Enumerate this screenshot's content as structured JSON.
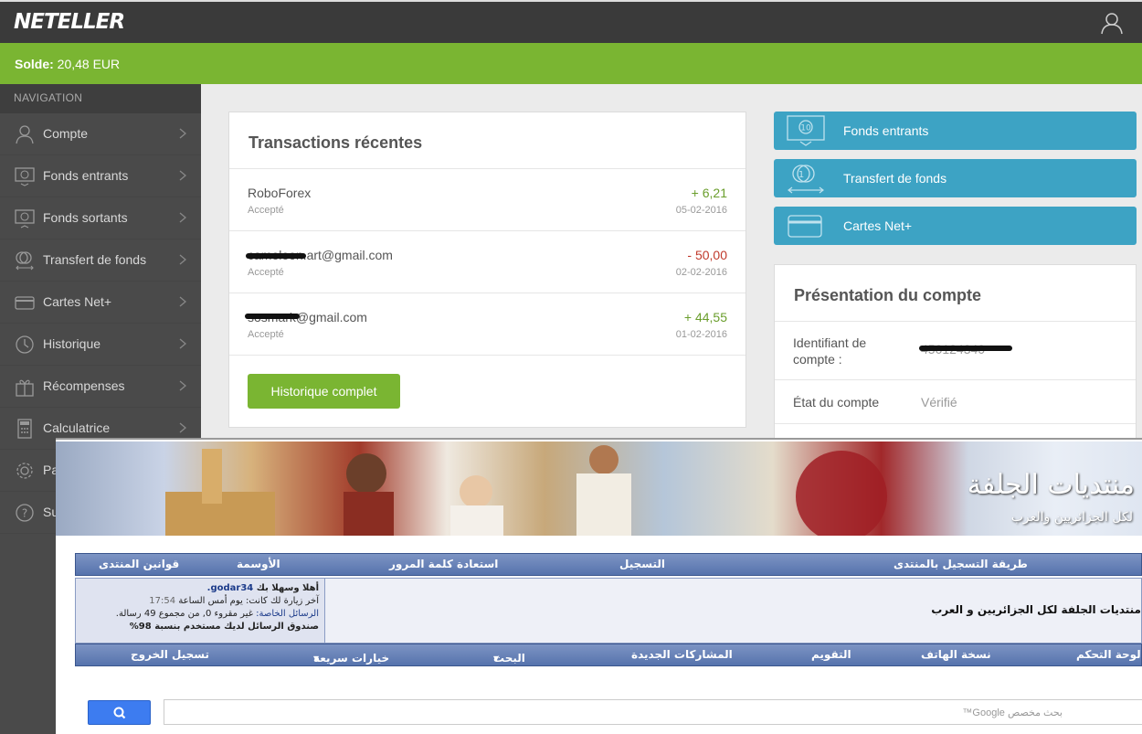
{
  "header": {
    "logo": "NETELLER",
    "user_icon": "user-icon"
  },
  "balance": {
    "label": "Solde:",
    "value": "20,48 EUR"
  },
  "sidebar": {
    "title": "NAVIGATION",
    "items": [
      {
        "label": "Compte",
        "icon": "user-icon"
      },
      {
        "label": "Fonds entrants",
        "icon": "money-in-icon"
      },
      {
        "label": "Fonds sortants",
        "icon": "money-out-icon"
      },
      {
        "label": "Transfert de fonds",
        "icon": "transfer-icon"
      },
      {
        "label": "Cartes Net+",
        "icon": "card-icon"
      },
      {
        "label": "Historique",
        "icon": "history-icon"
      },
      {
        "label": "Récompenses",
        "icon": "gift-icon"
      },
      {
        "label": "Calculatrice",
        "icon": "calculator-icon"
      },
      {
        "label": "Pa",
        "icon": "gear-icon"
      },
      {
        "label": "Su",
        "icon": "help-icon"
      }
    ]
  },
  "transactions": {
    "title": "Transactions récentes",
    "rows": [
      {
        "name": "RoboForex",
        "status": "Accepté",
        "amount": "+ 6,21",
        "date": "05-02-2016",
        "sign": "pos"
      },
      {
        "name": "cameleon.art@gmail.com",
        "status": "Accepté",
        "amount": "- 50,00",
        "date": "02-02-2016",
        "sign": "neg"
      },
      {
        "name": "sosmark@gmail.com",
        "status": "Accepté",
        "amount": "+ 44,55",
        "date": "01-02-2016",
        "sign": "pos"
      }
    ],
    "history_button": "Historique complet"
  },
  "actions": [
    {
      "label": "Fonds entrants",
      "icon": "money-in-icon"
    },
    {
      "label": "Transfert de fonds",
      "icon": "coins-transfer-icon"
    },
    {
      "label": "Cartes Net+",
      "icon": "card-icon"
    }
  ],
  "presentation": {
    "title": "Présentation du compte",
    "id_label": "Identifiant de compte :",
    "id_value": "450124340",
    "state_label": "État du compte",
    "state_value": "Vérifié"
  },
  "forum": {
    "banner_title": "منتديات الجلفة",
    "banner_subtitle": "لكل الجزائريين والعرب",
    "nav1": [
      "طريقة التسجيل بالمنتدى",
      "التسجيل",
      "استعادة كلمة المرور",
      "الأوسمة",
      "قوانين المنتدى"
    ],
    "welcome_line": "أهلا وسهلا بك",
    "username": "godar34.",
    "last_visit": "آخر زيارة لك كانت: يوم أمس الساعة",
    "last_visit_time": "17:54",
    "pm_link": "الرسائل الخاصة:",
    "pm_text": "غير مقروء 0, من مجموع 49 رسالة.",
    "inbox": "صندوق الرسائل لديك مستخدم بنسبة 98%",
    "forum_title": "منتديات الجلفة لكل الجزائريين و العرب",
    "nav2": [
      "لوحة التحكم",
      "نسخة الهاتف",
      "التقويم",
      "المشاركات الجديدة",
      "البحث",
      "خيارات سريعة",
      "تسجيل الخروج"
    ],
    "search_placeholder": "بحث مخصص Google™"
  },
  "colors": {
    "green": "#7ab532",
    "blue": "#3da3c4",
    "sidebar": "#4a4a4a",
    "topbar": "#3a3a3a"
  }
}
